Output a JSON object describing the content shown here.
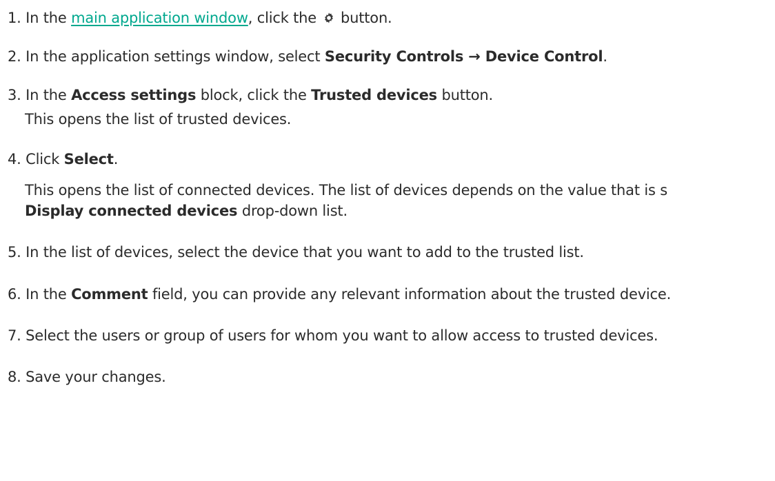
{
  "steps": [
    {
      "number": "1.",
      "pre": "In the",
      "link": "main application window",
      "post1": ", click the",
      "icon": "gear-icon",
      "post2": "button."
    },
    {
      "number": "2.",
      "pre": "In the application settings window, select",
      "bold": "Security Controls → Device Control",
      "post": "."
    },
    {
      "number": "3.",
      "pre": "In the",
      "bold1": "Access settings",
      "mid": "block, click the",
      "bold2": "Trusted devices",
      "post": "button.",
      "note": "This opens the list of trusted devices."
    },
    {
      "number": "4.",
      "pre": "Click",
      "bold": "Select",
      "post": ".",
      "note_line1": "This opens the list of connected devices. The list of devices depends on the value that is s",
      "note_bold": "Display connected devices",
      "note_line2_post": "drop-down list."
    },
    {
      "number": "5.",
      "text": "In the list of devices, select the device that you want to add to the trusted list."
    },
    {
      "number": "6.",
      "pre": "In the",
      "bold": "Comment",
      "post": "field, you can provide any relevant information about the trusted device."
    },
    {
      "number": "7.",
      "text": "Select the users or group of users for whom you want to allow access to trusted devices."
    },
    {
      "number": "8.",
      "text": "Save your changes."
    }
  ]
}
